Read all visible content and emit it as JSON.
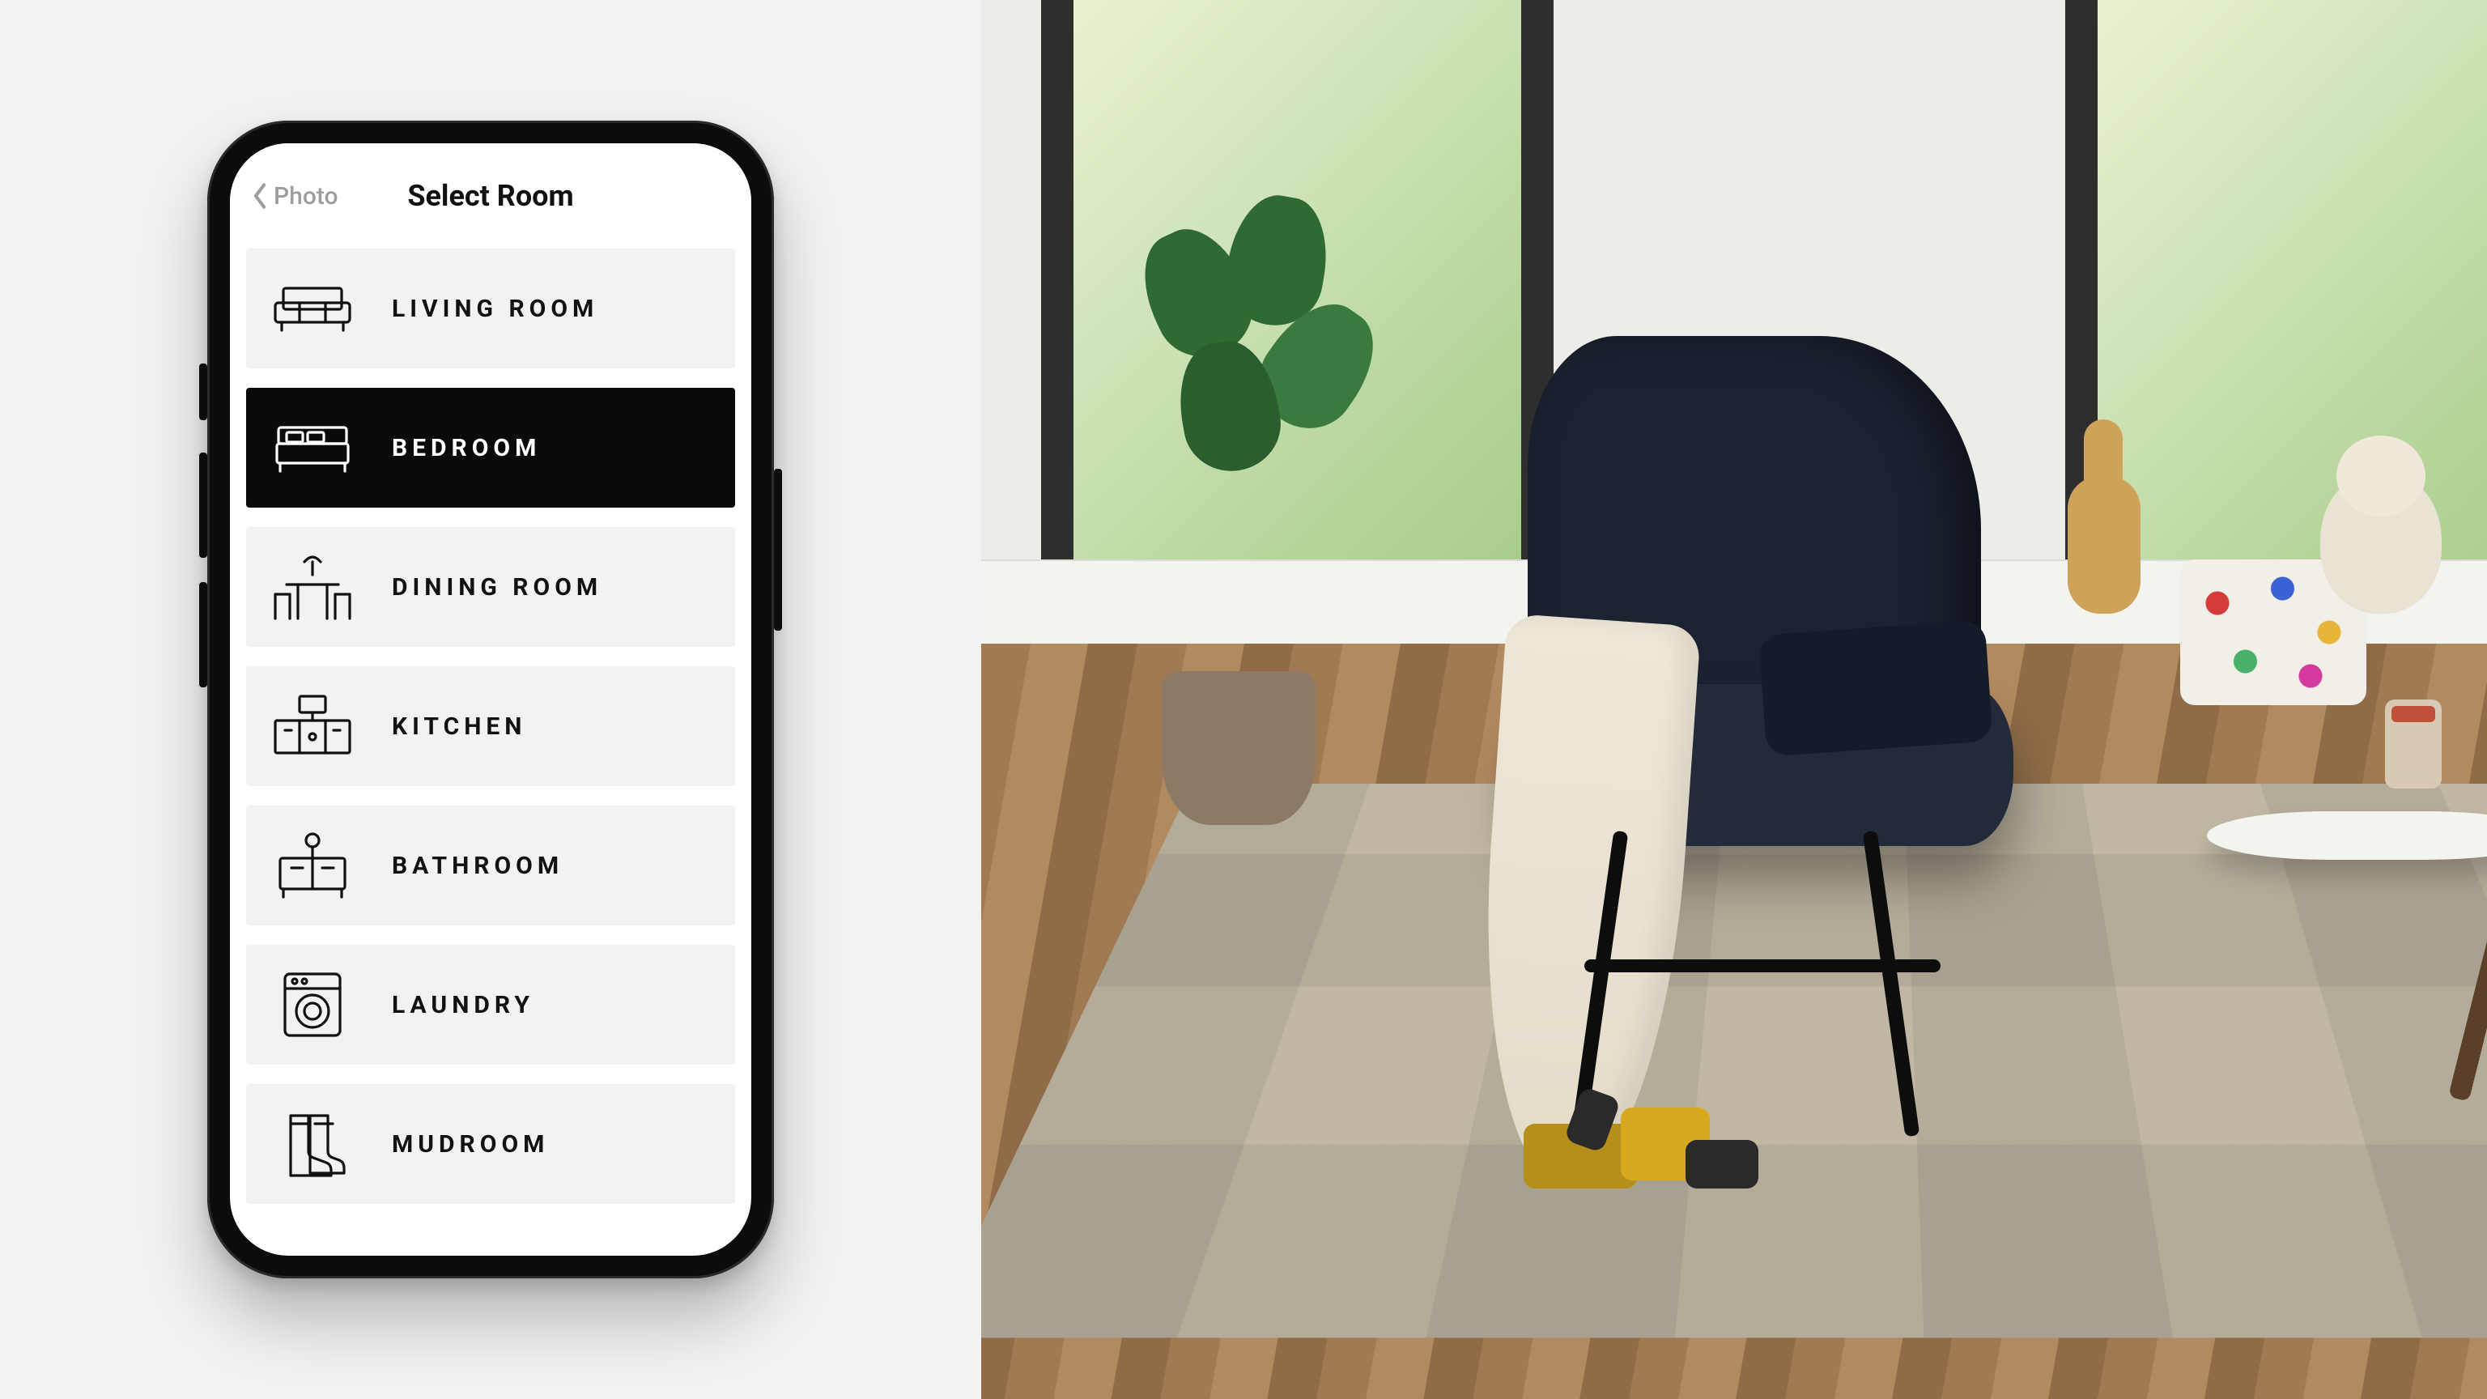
{
  "header": {
    "back_label": "Photo",
    "title": "Select Room"
  },
  "rooms": [
    {
      "id": "living-room",
      "label": "LIVING ROOM",
      "icon": "sofa-icon",
      "selected": false
    },
    {
      "id": "bedroom",
      "label": "BEDROOM",
      "icon": "bed-icon",
      "selected": true
    },
    {
      "id": "dining-room",
      "label": "DINING ROOM",
      "icon": "dining-icon",
      "selected": false
    },
    {
      "id": "kitchen",
      "label": "KITCHEN",
      "icon": "kitchen-icon",
      "selected": false
    },
    {
      "id": "bathroom",
      "label": "BATHROOM",
      "icon": "bath-icon",
      "selected": false
    },
    {
      "id": "laundry",
      "label": "LAUNDRY",
      "icon": "washer-icon",
      "selected": false
    },
    {
      "id": "mudroom",
      "label": "MUDROOM",
      "icon": "boots-icon",
      "selected": false
    }
  ],
  "colors": {
    "selected_bg": "#0a0a0a",
    "item_bg": "#f2f2f2",
    "text": "#111111",
    "muted": "#9d9d9d"
  }
}
